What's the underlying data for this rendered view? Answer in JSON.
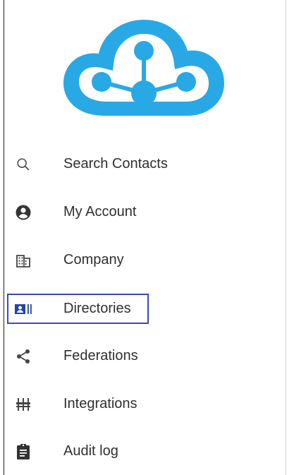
{
  "brand": {
    "logo_icon": "cloud-network-logo",
    "logo_color": "#29a8e6"
  },
  "nav": {
    "items": [
      {
        "label": "Search Contacts",
        "icon": "search-icon"
      },
      {
        "label": "My Account",
        "icon": "account-circle-icon"
      },
      {
        "label": "Company",
        "icon": "building-icon"
      },
      {
        "label": "Directories",
        "icon": "contact-card-icon",
        "selected": true
      },
      {
        "label": "Federations",
        "icon": "share-icon"
      },
      {
        "label": "Integrations",
        "icon": "integrations-icon"
      },
      {
        "label": "Audit log",
        "icon": "clipboard-icon"
      }
    ]
  },
  "colors": {
    "selected_border": "#3a46c7",
    "selected_icon": "#2345a8",
    "icon_default": "#555555",
    "text": "#2f2f2f"
  }
}
